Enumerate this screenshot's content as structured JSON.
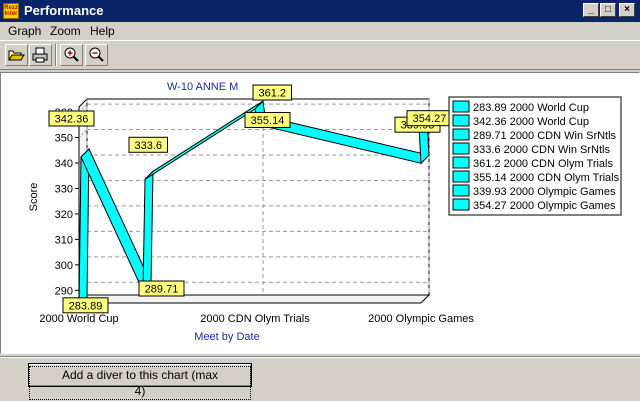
{
  "window": {
    "title": "Performance",
    "app_icon_text": "Rezz Inter"
  },
  "menu": {
    "items": [
      {
        "label": "Graph"
      },
      {
        "label": "Zoom"
      },
      {
        "label": "Help"
      }
    ]
  },
  "toolbar": {
    "buttons": [
      {
        "icon": "open-folder-icon"
      },
      {
        "icon": "print-icon"
      },
      {
        "icon": "zoom-in-icon"
      },
      {
        "icon": "zoom-out-icon"
      }
    ]
  },
  "chart_data": {
    "type": "line",
    "title": "W-10  ANNE M",
    "xlabel": "Meet by Date",
    "ylabel": "Score",
    "ylim": [
      285,
      362
    ],
    "yticks": [
      290,
      300,
      310,
      320,
      330,
      340,
      350,
      360
    ],
    "xticks": [
      "2000 World Cup",
      "2000 CDN Olym Trials",
      "2000 Olympic Games"
    ],
    "grid": true,
    "series_color": "#00ffff",
    "points": [
      {
        "value": 283.89,
        "meet": "2000 World Cup"
      },
      {
        "value": 342.36,
        "meet": "2000 World Cup"
      },
      {
        "value": 289.71,
        "meet": "2000 CDN Win SrNtls"
      },
      {
        "value": 333.6,
        "meet": "2000 CDN Win SrNtls"
      },
      {
        "value": 361.2,
        "meet": "2000 CDN Olym Trials"
      },
      {
        "value": 355.14,
        "meet": "2000 CDN Olym Trials"
      },
      {
        "value": 339.93,
        "meet": "2000 Olympic Games"
      },
      {
        "value": 354.27,
        "meet": "2000 Olympic Games"
      }
    ],
    "legend": [
      "283.89 2000 World Cup",
      "342.36 2000 World Cup",
      "289.71 2000 CDN Win SrNtls",
      "333.6 2000 CDN Win SrNtls",
      "361.2 2000 CDN Olym Trials",
      "355.14 2000 CDN Olym Trials",
      "339.93 2000 Olympic Games",
      "354.27 2000 Olympic Games"
    ],
    "legend_position": "right"
  },
  "footer": {
    "add_button_label": "Add a diver to this chart (max 4)"
  }
}
